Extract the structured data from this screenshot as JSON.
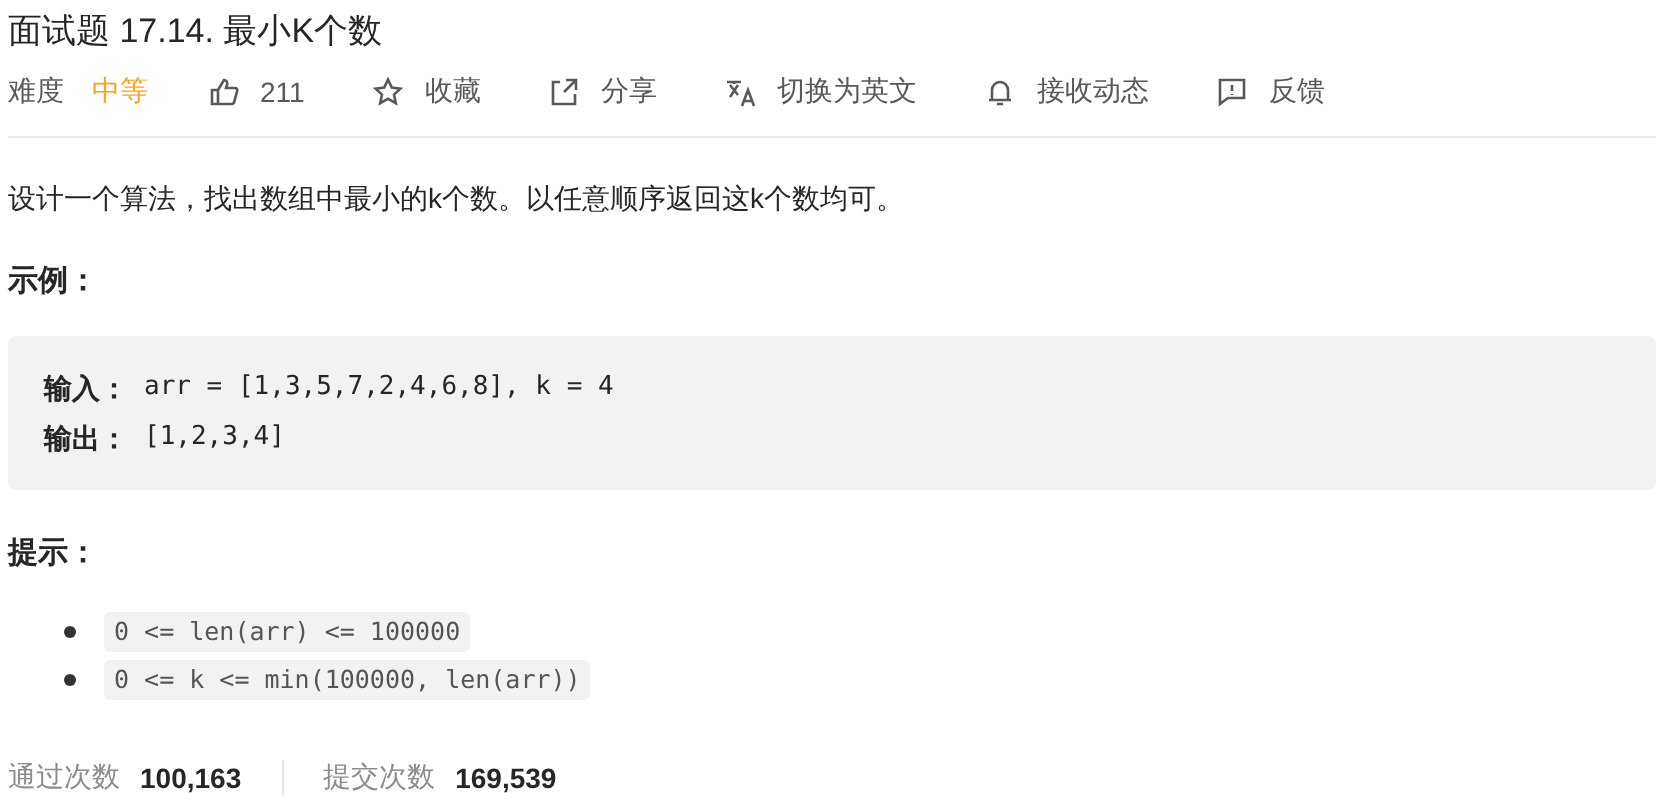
{
  "title": "面试题 17.14. 最小K个数",
  "toolbar": {
    "difficulty_label": "难度",
    "difficulty": "中等",
    "actions": [
      {
        "kind": "like",
        "label": "211"
      },
      {
        "kind": "star",
        "label": "收藏"
      },
      {
        "kind": "share",
        "label": "分享"
      },
      {
        "kind": "translate",
        "label": "切换为英文"
      },
      {
        "kind": "bell",
        "label": "接收动态"
      },
      {
        "kind": "feedback",
        "label": "反馈"
      }
    ]
  },
  "description": "设计一个算法，找出数组中最小的k个数。以任意顺序返回这k个数均可。",
  "example_heading": "示例：",
  "example": [
    {
      "label": "输入：",
      "value": "arr = [1,3,5,7,2,4,6,8], k = 4"
    },
    {
      "label": "输出：",
      "value": "[1,2,3,4]"
    }
  ],
  "hints_heading": "提示：",
  "hints": [
    "0 <= len(arr) <= 100000",
    "0 <= k <= min(100000, len(arr))"
  ],
  "stats": [
    {
      "label": "通过次数",
      "value": "100,163"
    },
    {
      "label": "提交次数",
      "value": "169,539"
    }
  ]
}
